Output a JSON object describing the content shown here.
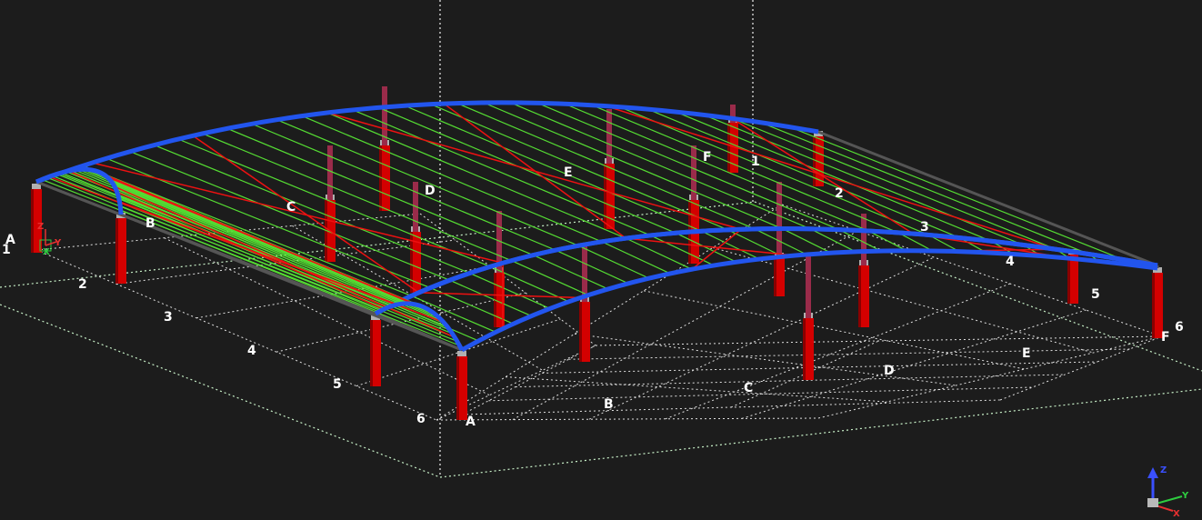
{
  "view": {
    "background": "#1c1c1c",
    "grid_color": "#e0e0e0",
    "boundary_color": "#c8f0c8"
  },
  "grid_labels": {
    "lower_frame": {
      "numbers": [
        "1",
        "2",
        "3",
        "4",
        "5",
        "6"
      ],
      "letters": [
        "A",
        "B",
        "C",
        "D"
      ]
    },
    "upper_frame": {
      "numbers": [
        "1",
        "2",
        "3",
        "4",
        "5",
        "6"
      ],
      "letters": [
        "A",
        "B",
        "C",
        "D",
        "E",
        "F"
      ]
    }
  },
  "local_triad": {
    "z": "Z",
    "y": "Y",
    "x": "X"
  },
  "view_triad": {
    "z": "Z",
    "y": "Y",
    "x": "X"
  },
  "colors": {
    "column": "#d40000",
    "column_dark": "#8a0000",
    "rafter": "#2255ee",
    "purlin": "#55dd33",
    "bracing": "#ee1111",
    "eave": "#555555",
    "strut": "#9a2b4a"
  }
}
